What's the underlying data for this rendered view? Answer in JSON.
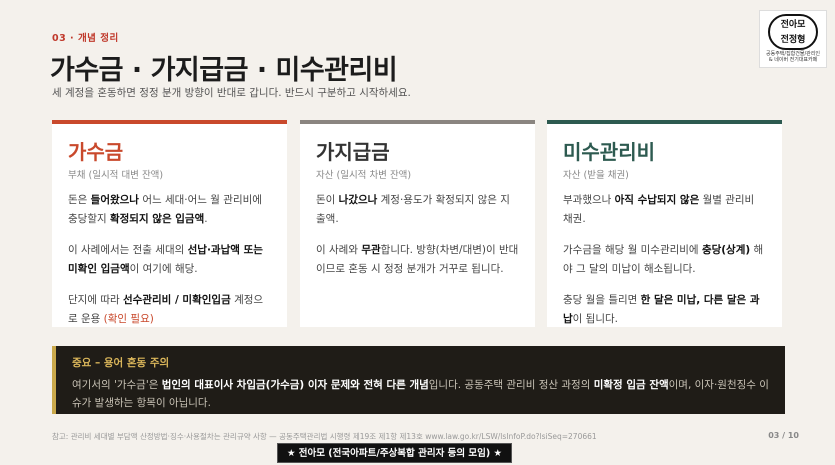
{
  "header": {
    "section_label": "03 · 개념 정리",
    "title": "가수금 · 가지급금 · 미수관리비",
    "subtitle": "세 계정을 혼동하면 정정 분개 방향이 반대로 갑니다. 반드시 구분하고 시작하세요."
  },
  "logo": {
    "mark_line1": "전아모",
    "mark_line2": "전정형",
    "sub_line1": "공동주택/집합건물/관리인",
    "sub_line2": "& 네이버 전기대표카페"
  },
  "cards": [
    {
      "title": "가수금",
      "tag": "부채 (일시적 대변 잔액)",
      "p1_a": "돈은 ",
      "p1_b": "들어왔으나",
      "p1_c": " 어느 세대·어느 월 관리비에 충당할지 ",
      "p1_d": "확정되지 않은 입금액",
      "p1_e": ".",
      "p2_a": "이 사례에서는 전출 세대의 ",
      "p2_b": "선납·과납액 또는 미확인 입금액",
      "p2_c": "이 여기에 해당.",
      "p3_a": "단지에 따라 ",
      "p3_b": "선수관리비 / 미확인입금",
      "p3_c": " 계정으로 운용 ",
      "p3_d": "(확인 필요)"
    },
    {
      "title": "가지급금",
      "tag": "자산 (일시적 차변 잔액)",
      "p1_a": "돈이 ",
      "p1_b": "나갔으나",
      "p1_c": " 계정·용도가 확정되지 않은 지출액.",
      "p2_a": "이 사례와 ",
      "p2_b": "무관",
      "p2_c": "합니다. 방향(차변/대변)이 반대이므로 혼동 시 정정 분개가 거꾸로 됩니다."
    },
    {
      "title": "미수관리비",
      "tag": "자산 (받을 채권)",
      "p1_a": "부과했으나 ",
      "p1_b": "아직 수납되지 않은",
      "p1_c": " 월별 관리비 채권.",
      "p2_a": "가수금을 해당 월 미수관리비에 ",
      "p2_b": "충당(상계)",
      "p2_c": " 해야 그 달의 미납이 해소됩니다.",
      "p3_a": "충당 월을 틀리면 ",
      "p3_b": "한 달은 미납, 다른 달은 과납",
      "p3_c": "이 됩니다."
    }
  ],
  "note": {
    "title": "중요 – 용어 혼동 주의",
    "body_a": "여기서의 '가수금'은 ",
    "body_b": "법인의 대표이사 차입금(가수금) 이자 문제와 전혀 다른 개념",
    "body_c": "입니다. 공동주택 관리비 정산 과정의 ",
    "body_d": "미확정 입금 잔액",
    "body_e": "이며, 이자·원천징수 이슈가 발생하는 항목이 아닙니다."
  },
  "footer": {
    "reference": "참고: 관리비 세대별 부담액 산정방법·징수·사용절차는 관리규약 사항 — 공동주택관리법 시행령 제19조 제1항 제13호 www.law.go.kr/LSW/lsInfoP.do?lsiSeq=270661",
    "page": "03 / 10",
    "badge": "★ 전아모 (전국아파트/주상복합 관리자 등의 모임) ★"
  }
}
